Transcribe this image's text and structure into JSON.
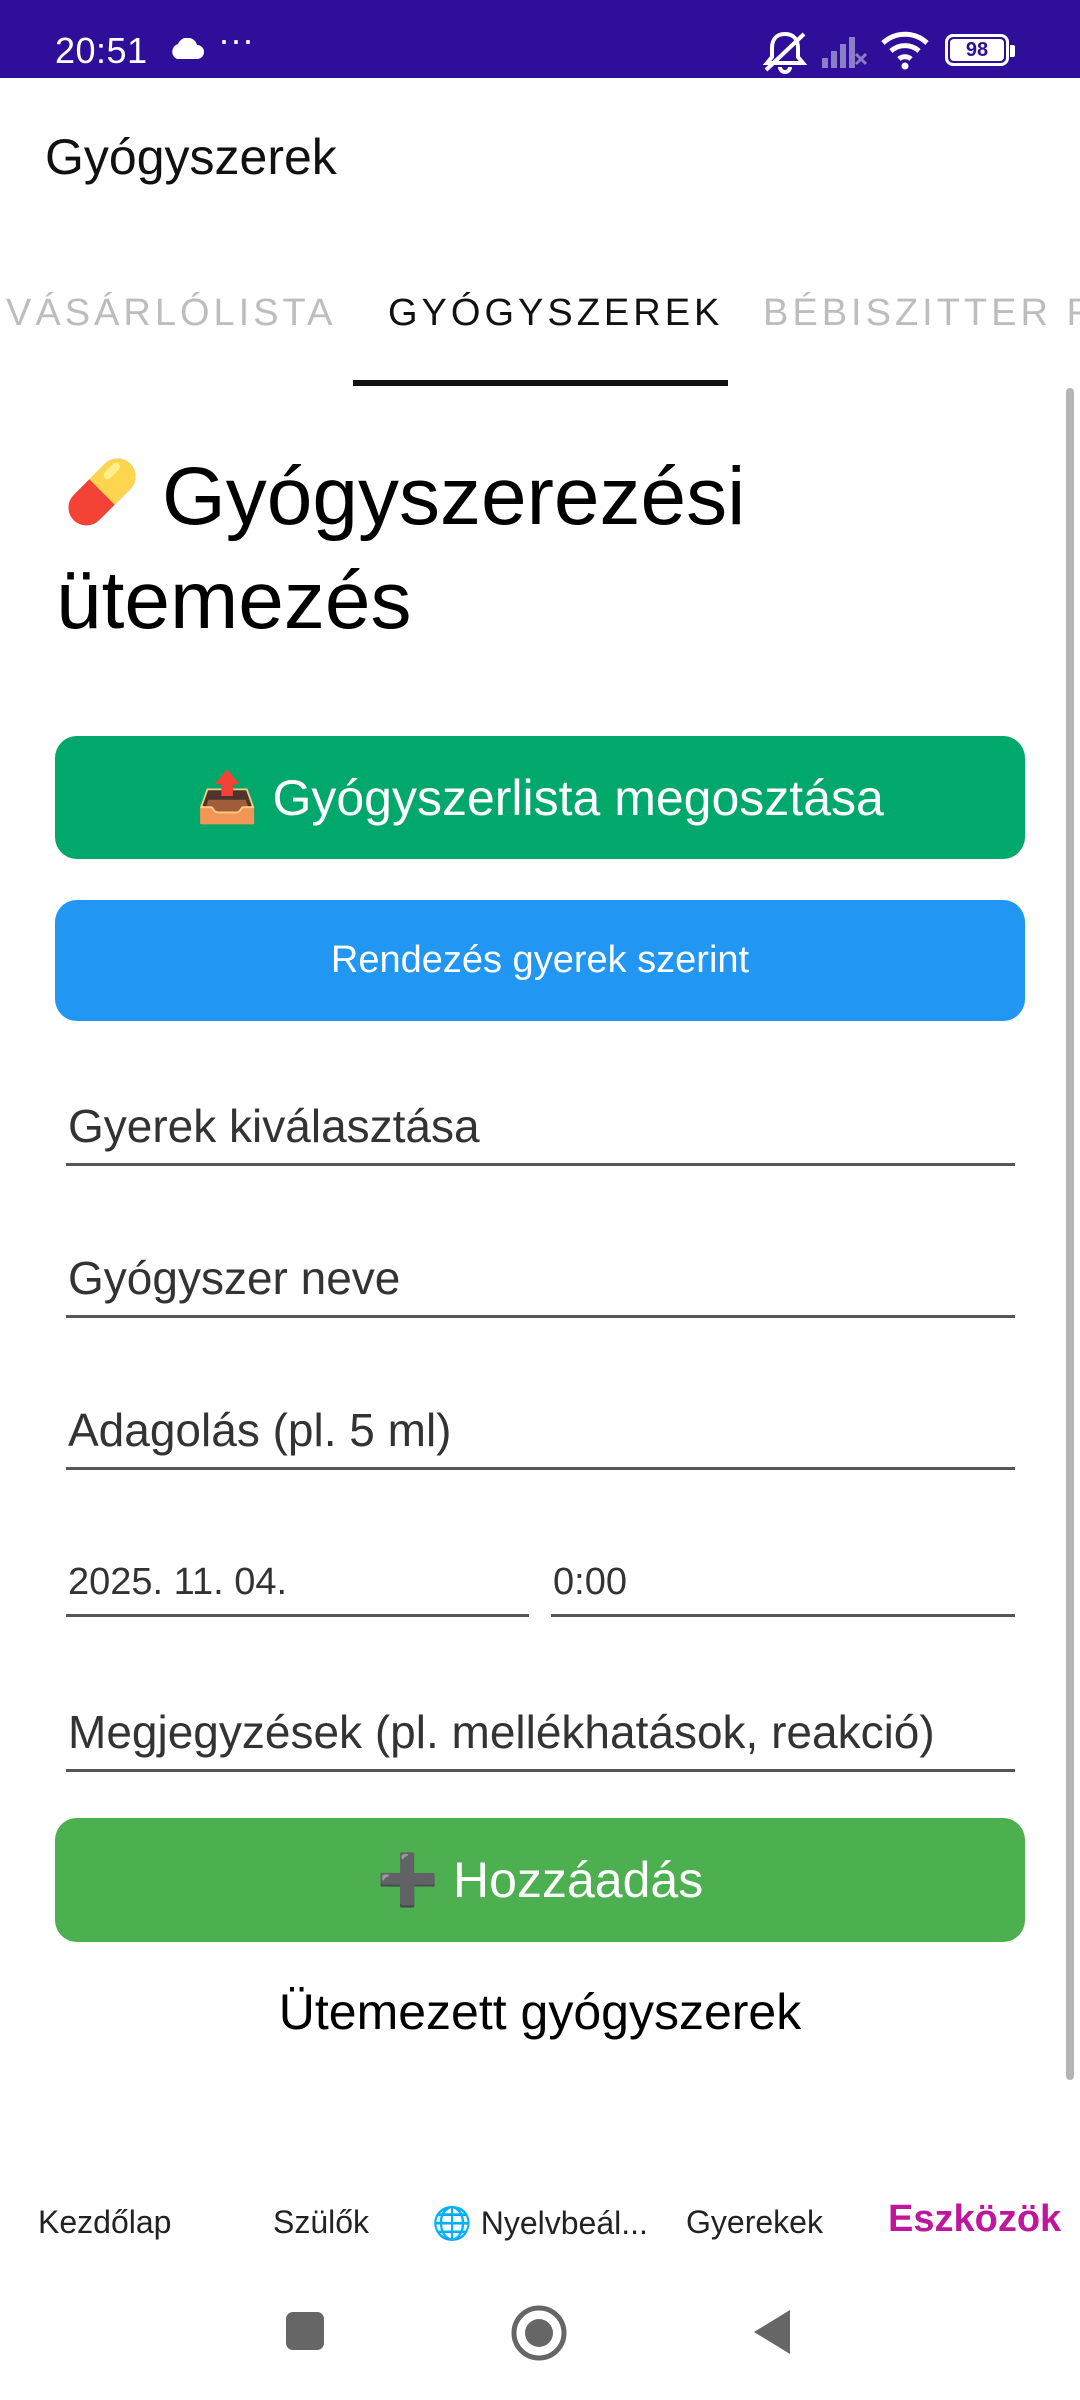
{
  "status_bar": {
    "time": "20:51",
    "dots": "···",
    "battery": "98",
    "icons": [
      "cloud-icon",
      "muted-icon",
      "signal-icon",
      "wifi-icon",
      "battery-icon"
    ]
  },
  "app_bar": {
    "title": "Gyógyszerek"
  },
  "tabs": [
    {
      "label": "VÁSÁRLÓLISTA",
      "active": false
    },
    {
      "label": "GYÓGYSZEREK",
      "active": true
    },
    {
      "label": "BÉBISZITTER FI",
      "active": false
    }
  ],
  "main": {
    "heading_line1": "Gyógyszerezési",
    "heading_line2": "ütemezés",
    "share_button": {
      "icon": "📤",
      "label": "Gyógyszerlista megosztása"
    },
    "sort_button": {
      "label": "Rendezés gyerek szerint"
    },
    "inputs": {
      "child_placeholder": "Gyerek kiválasztása",
      "medicine_placeholder": "Gyógyszer neve",
      "dosage_placeholder": "Adagolás (pl. 5 ml)",
      "date_value": "2025. 11. 04.",
      "time_value": "0:00",
      "notes_placeholder": "Megjegyzések (pl. mellékhatások, reakció)"
    },
    "add_button": {
      "icon": "➕",
      "label": "Hozzáadás"
    },
    "scheduled_title": "Ütemezett gyógyszerek"
  },
  "bottom_nav": [
    {
      "label": "Kezdőlap",
      "active": false
    },
    {
      "label": "Szülők",
      "active": false
    },
    {
      "label": "🌐 Nyelvbeál...",
      "active": false
    },
    {
      "label": "Gyerekek",
      "active": false
    },
    {
      "label": "Eszközök",
      "active": true
    }
  ],
  "colors": {
    "status_bar": "#2f0f9a",
    "share_button": "#00a86b",
    "sort_button": "#2196f3",
    "add_button": "#4caf50",
    "active_nav": "#c0169d"
  }
}
